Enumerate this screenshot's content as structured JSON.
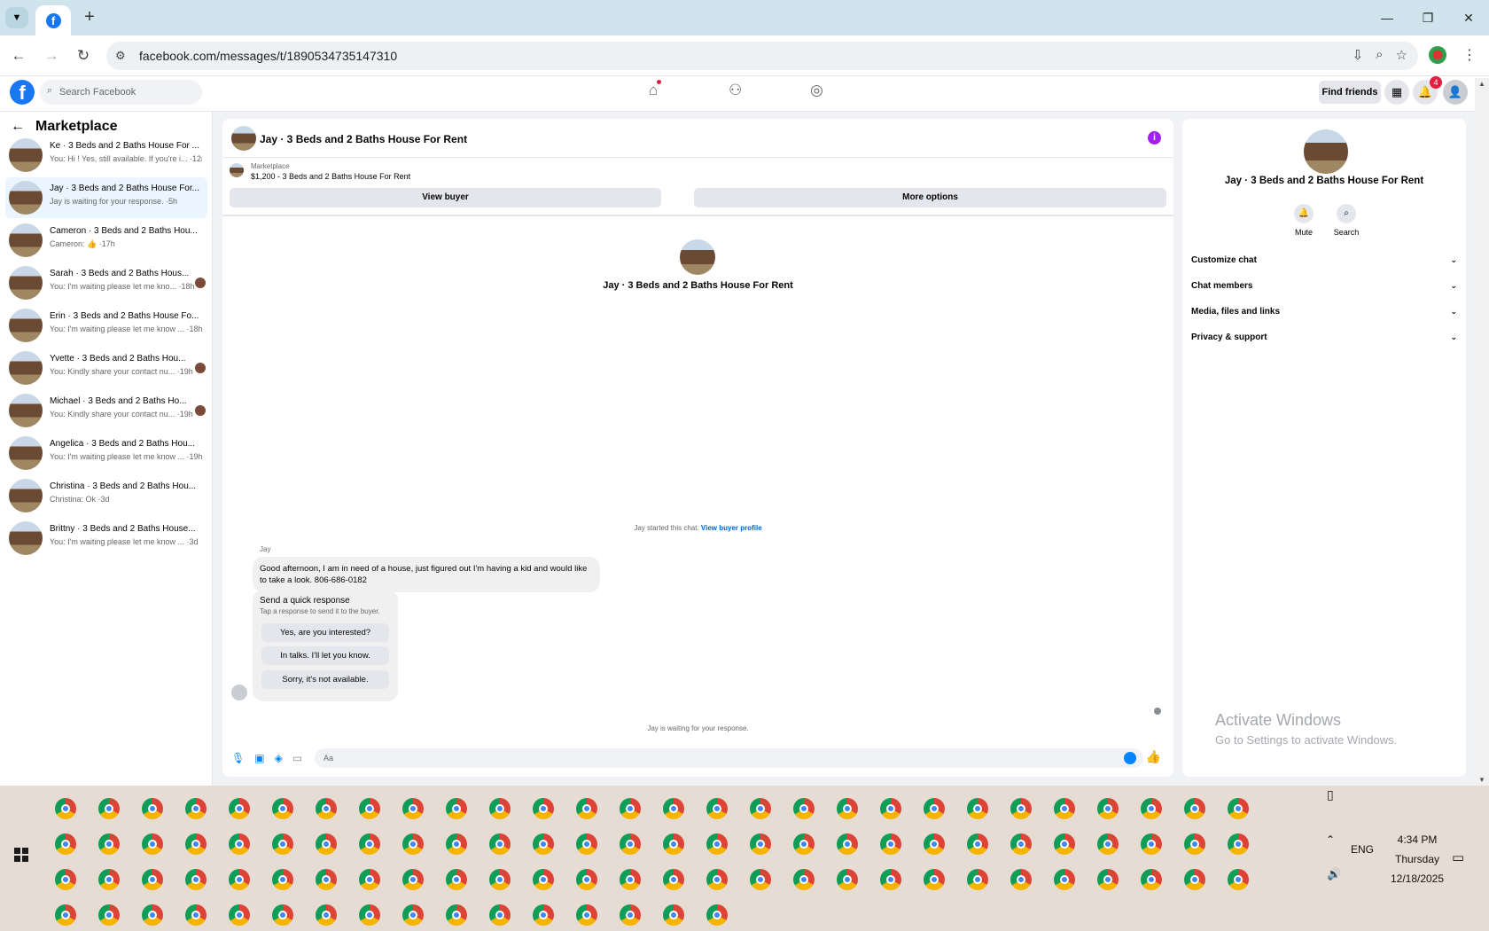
{
  "browser": {
    "url": "facebook.com/messages/t/1890534735147310",
    "tab_list_icon": "chevron-down-icon",
    "new_tab_label": "+",
    "window_controls": [
      "—",
      "❐",
      "✕"
    ]
  },
  "fb_header": {
    "logo": "f",
    "search_placeholder": "Search Facebook",
    "find_friends_label": "Find friends",
    "notifications_count": "4"
  },
  "sidebar": {
    "title": "Marketplace",
    "conversations": [
      {
        "name": "Ke · 3 Beds and 2 Baths House For ...",
        "preview": "You: Hi ! Yes, still available. If you're i... ·12m",
        "active": false,
        "mini_avatar": false
      },
      {
        "name": "Jay · 3 Beds and 2 Baths House For...",
        "preview": "Jay is waiting for your response. ·5h",
        "active": true,
        "mini_avatar": false
      },
      {
        "name": "Cameron · 3 Beds and 2 Baths Hou...",
        "preview": "Cameron: 👍 ·17h",
        "active": false,
        "mini_avatar": false
      },
      {
        "name": "Sarah · 3 Beds and 2 Baths Hous...",
        "preview": "You: I'm waiting please let me kno... ·18h",
        "active": false,
        "mini_avatar": true
      },
      {
        "name": "Erin · 3 Beds and 2 Baths House Fo...",
        "preview": "You: I'm waiting please let me know ... ·18h",
        "active": false,
        "mini_avatar": false
      },
      {
        "name": "Yvette · 3 Beds and 2 Baths Hou...",
        "preview": "You: Kindly share your contact nu... ·19h",
        "active": false,
        "mini_avatar": true
      },
      {
        "name": "Michael · 3 Beds and 2 Baths Ho...",
        "preview": "You: Kindly share your contact nu... ·19h",
        "active": false,
        "mini_avatar": true
      },
      {
        "name": "Angelica · 3 Beds and 2 Baths Hou...",
        "preview": "You: I'm waiting please let me know ... ·19h",
        "active": false,
        "mini_avatar": false
      },
      {
        "name": "Christina · 3 Beds and 2 Baths Hou...",
        "preview": "Christina: Ok ·3d",
        "active": false,
        "mini_avatar": false
      },
      {
        "name": "Brittny · 3 Beds and 2 Baths House...",
        "preview": "You: I'm waiting please let me know ... ·3d",
        "active": false,
        "mini_avatar": false
      }
    ]
  },
  "chat": {
    "title": "Jay · 3 Beds and 2 Baths House For Rent",
    "listing_label": "Marketplace",
    "listing_desc": "$1,200 - 3 Beds and 2 Baths House For Rent",
    "view_buyer_label": "View buyer",
    "more_options_label": "More options",
    "center_name": "Jay · 3 Beds and 2 Baths House For Rent",
    "started_text": "Jay started this chat.",
    "view_profile_link": "View buyer profile",
    "sender": "Jay",
    "message": "Good afternoon, I am in need of a house, just figured out I'm having a kid and would like to take a look. 806-686-0182",
    "quick_title": "Send a quick response",
    "quick_sub": "Tap a response to send it to the buyer.",
    "quick_responses": [
      "Yes, are you interested?",
      "In talks. I'll let you know.",
      "Sorry, it's not available."
    ],
    "waiting_text": "Jay is waiting for your response.",
    "composer_placeholder": "Aa"
  },
  "info_panel": {
    "name": "Jay · 3 Beds and 2 Baths House For Rent",
    "mute_label": "Mute",
    "search_label": "Search",
    "rows": [
      "Customize chat",
      "Chat members",
      "Media, files and links",
      "Privacy & support"
    ]
  },
  "watermark": {
    "line1": "Activate Windows",
    "line2": "Go to Settings to activate Windows."
  },
  "taskbar": {
    "language": "ENG",
    "time": "4:34 PM",
    "day": "Thursday",
    "date": "12/18/2025"
  }
}
